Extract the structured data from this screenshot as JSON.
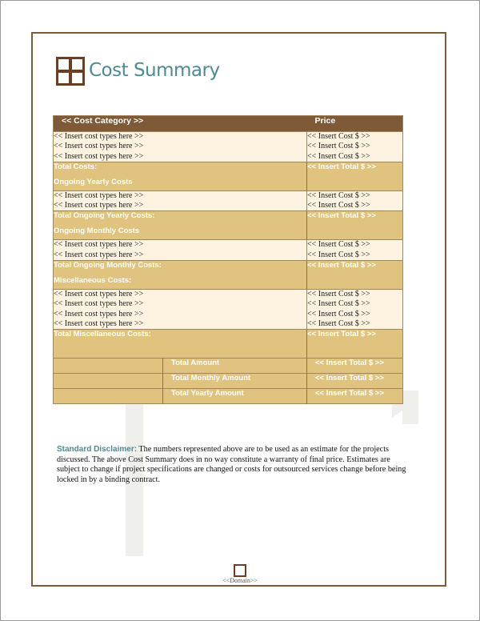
{
  "document": {
    "title": "Cost Summary",
    "footer_label": "<<Domain>>",
    "colors": {
      "accent_teal": "#4f8a93",
      "brown": "#7e5a39",
      "gold": "#e0c37e",
      "cream": "#fdf3e0"
    }
  },
  "table": {
    "header": {
      "category": "<< Cost Category >>",
      "price": "Price"
    },
    "sections": [
      {
        "items": [
          {
            "type": "<< Insert cost types here >>",
            "cost": "<< Insert Cost $ >>"
          },
          {
            "type": "<< Insert cost types here >>",
            "cost": "<< Insert Cost $ >>"
          },
          {
            "type": "<< Insert cost types here >>",
            "cost": "<< Insert Cost $ >>"
          }
        ],
        "total_label": "Total Costs:",
        "total_value": "<< Insert Total $ >>",
        "next_heading": "Ongoing Yearly Costs"
      },
      {
        "items": [
          {
            "type": "<< Insert cost types here >>",
            "cost": "<< Insert Cost $ >>"
          },
          {
            "type": "<< Insert cost types here >>",
            "cost": "<< Insert Cost $ >>"
          }
        ],
        "total_label": "Total Ongoing Yearly Costs:",
        "total_value": "<< Insert Total $ >>",
        "next_heading": "Ongoing Monthly Costs"
      },
      {
        "items": [
          {
            "type": "<< Insert cost types here >>",
            "cost": "<< Insert Cost $ >>"
          },
          {
            "type": "<< Insert cost types here >>",
            "cost": "<< Insert Cost $ >>"
          }
        ],
        "total_label": "Total Ongoing Monthly Costs:",
        "total_value": "<< Insert Total $ >>",
        "next_heading": "Miscellaneous Costs:"
      },
      {
        "items": [
          {
            "type": "<< Insert cost types here >>",
            "cost": "<< Insert Cost $ >>"
          },
          {
            "type": "<< Insert cost types here >>",
            "cost": "<< Insert Cost $ >>"
          },
          {
            "type": "<< Insert cost types here >>",
            "cost": "<< Insert Cost $ >>"
          },
          {
            "type": "<< Insert cost types here >>",
            "cost": "<< Insert Cost $ >>"
          }
        ],
        "total_label": "Total Miscellaneous Costs:",
        "total_value": "<< Insert Total $ >>",
        "next_heading": ""
      }
    ],
    "summary": [
      {
        "label": "Total Amount",
        "value": "<< Insert Total $ >>"
      },
      {
        "label": "Total Monthly Amount",
        "value": "<< Insert Total $ >>"
      },
      {
        "label": "Total Yearly Amount",
        "value": "<< Insert Total $ >>"
      }
    ]
  },
  "disclaimer": {
    "label": "Standard Disclaimer:",
    "text": " The numbers represented above are to be used as an estimate for the projects discussed. The above Cost Summary does in no way constitute a warranty of final price.  Estimates are subject to change if project specifications are changed or costs for outsourced services change before being locked in by a binding contract."
  }
}
